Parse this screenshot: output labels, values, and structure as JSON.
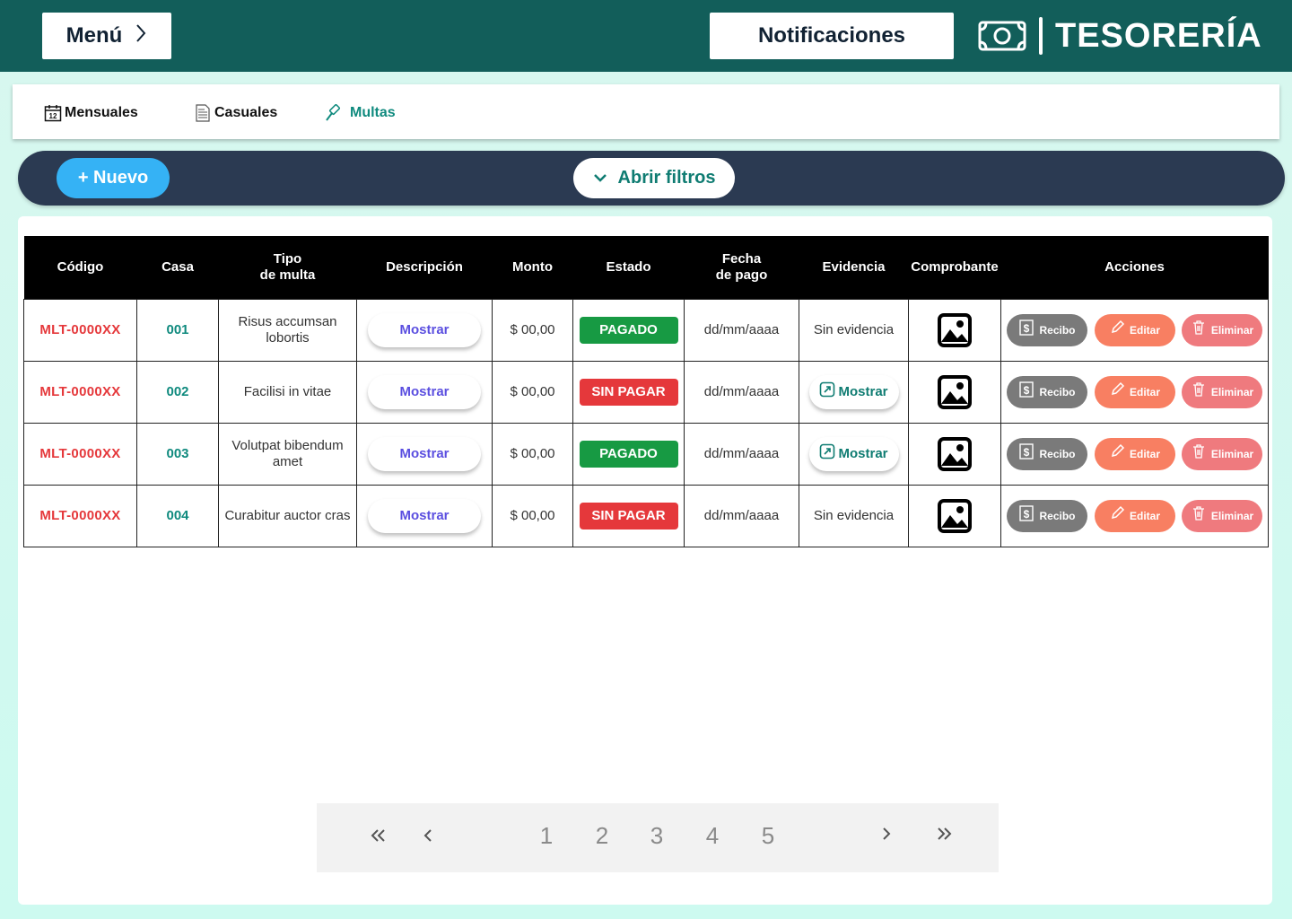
{
  "header": {
    "menu_label": "Menú",
    "notifications_label": "Notificaciones",
    "brand_title": "TESORERÍA"
  },
  "tabs": [
    {
      "label": "Mensuales",
      "icon": "calendar-icon",
      "active": false
    },
    {
      "label": "Casuales",
      "icon": "document-icon",
      "active": false
    },
    {
      "label": "Multas",
      "icon": "gavel-icon",
      "active": true
    }
  ],
  "toolbar": {
    "new_label": "+ Nuevo",
    "filters_label": "Abrir filtros"
  },
  "table": {
    "headers": [
      "Código",
      "Casa",
      "Tipo\nde multa",
      "Descripción",
      "Monto",
      "Estado",
      "Fecha\nde pago",
      "Evidencia",
      "Comprobante",
      "Acciones"
    ],
    "headers_display": {
      "codigo": "Código",
      "casa": "Casa",
      "tipo_1": "Tipo",
      "tipo_2": "de multa",
      "descripcion": "Descripción",
      "monto": "Monto",
      "estado": "Estado",
      "fecha_1": "Fecha",
      "fecha_2": "de pago",
      "evidencia": "Evidencia",
      "comprobante": "Comprobante",
      "acciones": "Acciones"
    },
    "rows": [
      {
        "code": "MLT-0000XX",
        "casa": "001",
        "tipo": "Risus accumsan lobortis",
        "desc_label": "Mostrar",
        "monto": "$ 00,00",
        "estado": "PAGADO",
        "paid": true,
        "fecha": "dd/mm/aaaa",
        "evidencia": "Sin evidencia",
        "has_evidence": false
      },
      {
        "code": "MLT-0000XX",
        "casa": "002",
        "tipo": "Facilisi in vitae",
        "desc_label": "Mostrar",
        "monto": "$ 00,00",
        "estado": "SIN PAGAR",
        "paid": false,
        "fecha": "dd/mm/aaaa",
        "evidencia": "Mostrar",
        "has_evidence": true
      },
      {
        "code": "MLT-0000XX",
        "casa": "003",
        "tipo": "Volutpat bibendum amet",
        "desc_label": "Mostrar",
        "monto": "$ 00,00",
        "estado": "PAGADO",
        "paid": true,
        "fecha": "dd/mm/aaaa",
        "evidencia": "Mostrar",
        "has_evidence": true
      },
      {
        "code": "MLT-0000XX",
        "casa": "004",
        "tipo": "Curabitur auctor cras",
        "desc_label": "Mostrar",
        "monto": "$ 00,00",
        "estado": "SIN PAGAR",
        "paid": false,
        "fecha": "dd/mm/aaaa",
        "evidencia": "Sin evidencia",
        "has_evidence": false
      }
    ],
    "actions": {
      "recibo": "Recibo",
      "editar": "Editar",
      "eliminar": "Eliminar"
    }
  },
  "pagination": {
    "pages": [
      "1",
      "2",
      "3",
      "4",
      "5"
    ]
  },
  "colors": {
    "topbar": "#125e5a",
    "accent": "#0f8a7e",
    "paid": "#179a43",
    "unpaid": "#e5383b",
    "new_button": "#35b2f5",
    "action_bar": "#2b3a52"
  }
}
